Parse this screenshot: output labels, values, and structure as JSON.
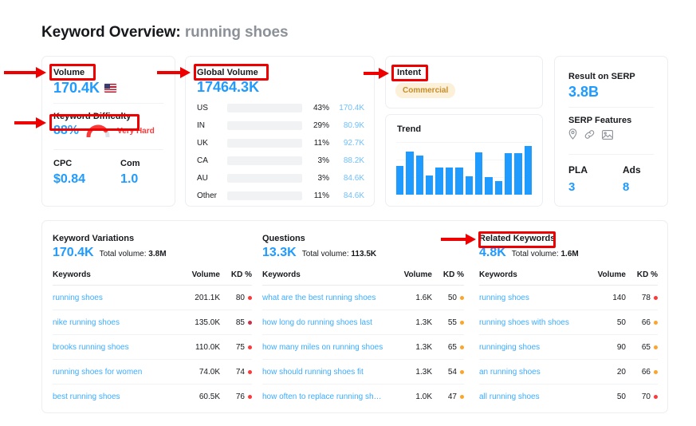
{
  "header": {
    "title_prefix": "Keyword Overview:",
    "keyword": "running shoes"
  },
  "volume_card": {
    "volume_label": "Volume",
    "volume_value": "170.4K",
    "country_flag_icon": "us-flag-icon",
    "kd_label": "Keyword Difficulty",
    "kd_value": "88%",
    "kd_verdict": "Very Hard",
    "cpc_label": "CPC",
    "cpc_value": "$0.84",
    "com_label": "Com",
    "com_value": "1.0"
  },
  "global_volume_card": {
    "label": "Global Volume",
    "value": "17464.3K",
    "rows": [
      {
        "country": "US",
        "percent": "43%",
        "pct_num": 43,
        "bar": 60,
        "volume": "170.4K"
      },
      {
        "country": "IN",
        "percent": "29%",
        "pct_num": 29,
        "bar": 28,
        "volume": "80.9K"
      },
      {
        "country": "UK",
        "percent": "11%",
        "pct_num": 11,
        "bar": 31,
        "volume": "92.7K"
      },
      {
        "country": "CA",
        "percent": "3%",
        "pct_num": 3,
        "bar": 10,
        "volume": "88.2K"
      },
      {
        "country": "AU",
        "percent": "3%",
        "pct_num": 3,
        "bar": 10,
        "volume": "84.6K"
      },
      {
        "country": "Other",
        "percent": "11%",
        "pct_num": 11,
        "bar": 24,
        "volume": "84.6K"
      }
    ]
  },
  "intent_card": {
    "label": "Intent",
    "badge": "Commercial",
    "badge_bg": "#fcf0d9",
    "badge_color": "#c58d2a"
  },
  "trend_card": {
    "label": "Trend",
    "bar_color": "#1f9bff",
    "bars": [
      55,
      82,
      74,
      36,
      52,
      52,
      52,
      35,
      80,
      34,
      26,
      79,
      79,
      93
    ]
  },
  "serp_card": {
    "result_label": "Result on SERP",
    "result_value": "3.8B",
    "features_label": "SERP Features",
    "features": [
      "map-pin-icon",
      "link-icon",
      "image-icon"
    ],
    "pla_label": "PLA",
    "pla_value": "3",
    "ads_label": "Ads",
    "ads_value": "8"
  },
  "tables": {
    "columns": [
      "Keywords",
      "Volume",
      "KD %"
    ],
    "variations": {
      "title": "Keyword Variations",
      "count": "170.4K",
      "total_label": "Total volume:",
      "total_value": "3.8M",
      "rows": [
        {
          "keyword": "running shoes",
          "volume": "201.1K",
          "kd": "80",
          "dot": "#fb3a3a"
        },
        {
          "keyword": "nike running shoes",
          "volume": "135.0K",
          "kd": "85",
          "dot": "#c7314a"
        },
        {
          "keyword": "brooks running shoes",
          "volume": "110.0K",
          "kd": "75",
          "dot": "#fb3a3a"
        },
        {
          "keyword": "running shoes for women",
          "volume": "74.0K",
          "kd": "74",
          "dot": "#fb3a3a"
        },
        {
          "keyword": "best running shoes",
          "volume": "60.5K",
          "kd": "76",
          "dot": "#fb3a3a"
        }
      ]
    },
    "questions": {
      "title": "Questions",
      "count": "13.3K",
      "total_label": "Total volume:",
      "total_value": "113.5K",
      "rows": [
        {
          "keyword": "what are the best running shoes",
          "volume": "1.6K",
          "kd": "50",
          "dot": "#fca52b"
        },
        {
          "keyword": "how long do running shoes last",
          "volume": "1.3K",
          "kd": "55",
          "dot": "#fca52b"
        },
        {
          "keyword": "how many miles on running shoes",
          "volume": "1.3K",
          "kd": "65",
          "dot": "#fca52b"
        },
        {
          "keyword": "how should running shoes fit",
          "volume": "1.3K",
          "kd": "54",
          "dot": "#fca52b"
        },
        {
          "keyword": "how often to replace running shoes",
          "volume": "1.0K",
          "kd": "47",
          "dot": "#fca52b"
        }
      ]
    },
    "related": {
      "title": "Related Keywords",
      "count": "4.8K",
      "total_label": "Total volume:",
      "total_value": "1.6M",
      "rows": [
        {
          "keyword": "running shoes",
          "volume": "140",
          "kd": "78",
          "dot": "#fb3a3a"
        },
        {
          "keyword": "running shoes with shoes",
          "volume": "50",
          "kd": "66",
          "dot": "#fca52b"
        },
        {
          "keyword": "runninging shoes",
          "volume": "90",
          "kd": "65",
          "dot": "#fca52b"
        },
        {
          "keyword": "an running shoes",
          "volume": "20",
          "kd": "66",
          "dot": "#fca52b"
        },
        {
          "keyword": "all running shoes",
          "volume": "50",
          "kd": "70",
          "dot": "#fb3a3a"
        }
      ]
    }
  },
  "annotations": {
    "color": "#ee0000",
    "highlighted": [
      "Volume",
      "Keyword Difficulty",
      "Global Volume",
      "Intent",
      "Related Keywords"
    ]
  }
}
